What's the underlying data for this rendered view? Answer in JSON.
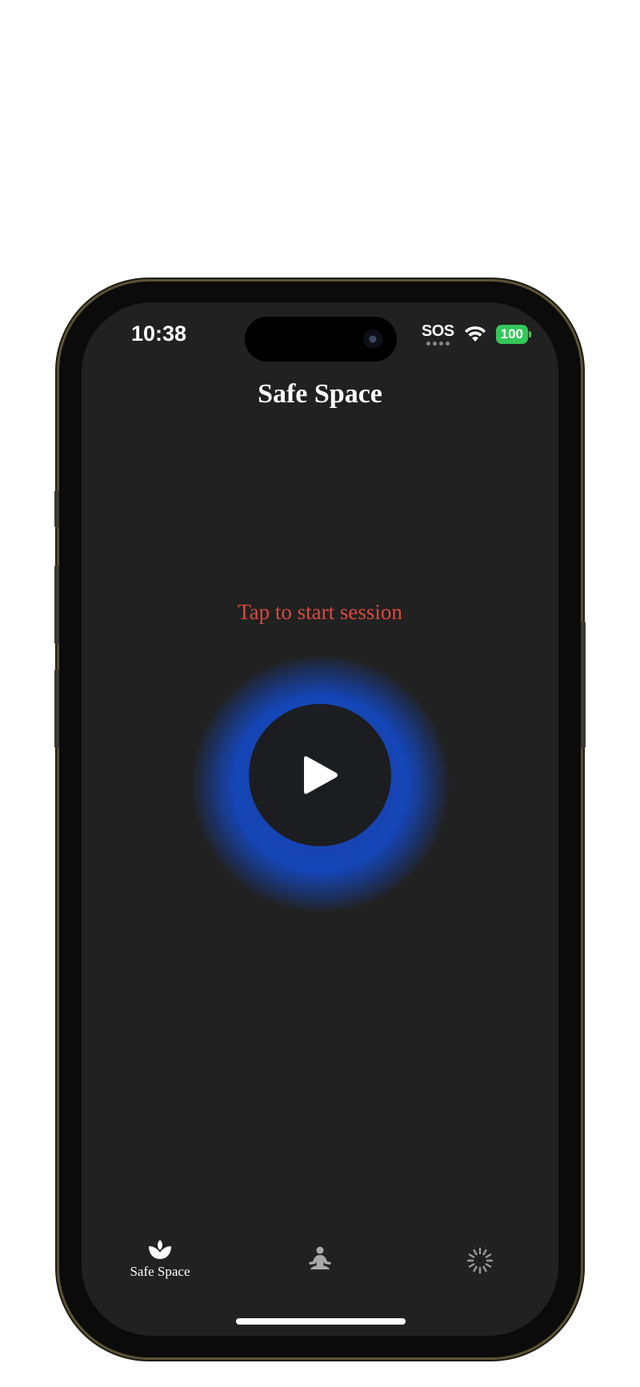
{
  "status_bar": {
    "time": "10:38",
    "sos": "SOS",
    "battery": "100"
  },
  "nav": {
    "title": "Safe Space"
  },
  "main": {
    "prompt": "Tap to start session",
    "play_icon": "play-icon",
    "glow_color": "#1546b8",
    "prompt_color": "#d94a3d"
  },
  "tabbar": {
    "tabs": [
      {
        "label": "Safe Space",
        "icon": "lotus-icon",
        "selected": true
      },
      {
        "label": "",
        "icon": "meditation-icon",
        "selected": false
      },
      {
        "label": "",
        "icon": "loading-spinner-icon",
        "selected": false
      }
    ]
  },
  "colors": {
    "background": "#212121",
    "accent_battery": "#34c759"
  }
}
